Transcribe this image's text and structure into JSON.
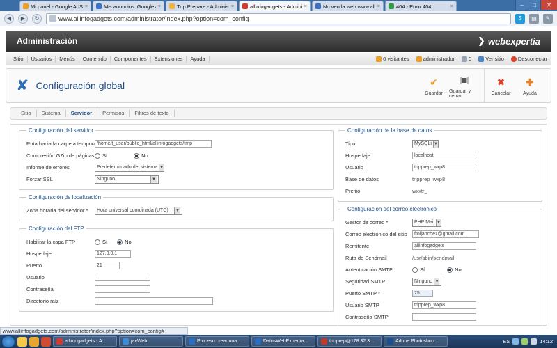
{
  "browser": {
    "tabs": [
      {
        "label": "Mi panel - Google AdSense",
        "color": "#f29d1e",
        "active": false
      },
      {
        "label": "Mis anuncios: Google AdWords",
        "color": "#3a73c9",
        "active": false
      },
      {
        "label": "Trip Prepare - Administración",
        "color": "#f1b33b",
        "active": false
      },
      {
        "label": "allinfogadgets - Administración",
        "color": "#d03b2d",
        "active": true
      },
      {
        "label": "No veo la web www.allinfogadgets",
        "color": "#3c6fc4",
        "active": false
      },
      {
        "label": "404 - Error 404",
        "color": "#2f9e44",
        "active": false
      }
    ],
    "url": "www.allinfogadgets.com/administrator/index.php?option=com_config"
  },
  "admin": {
    "title": "Administración",
    "brand": "webexpertia"
  },
  "menu": {
    "items": [
      "Sitio",
      "Usuarios",
      "Menús",
      "Contenido",
      "Componentes",
      "Extensiones",
      "Ayuda"
    ],
    "right": {
      "visitors": "0 visitantes",
      "admin": "administrador",
      "messages": "0",
      "view_site": "Ver sitio",
      "logout": "Desconectar"
    }
  },
  "toolbar": {
    "title": "Configuración global",
    "actions": [
      {
        "name": "save-button",
        "label": "Guardar",
        "icon": "check-icon",
        "glyph": "✔",
        "color": "#f39a1f"
      },
      {
        "name": "save-close-button",
        "label": "Guardar y cerrar",
        "icon": "disk-icon",
        "glyph": "▣",
        "color": "#555555"
      },
      {
        "name": "cancel-button",
        "label": "Cancelar",
        "icon": "cancel-icon",
        "glyph": "✖",
        "color": "#e0402b"
      },
      {
        "name": "help-button",
        "label": "Ayuda",
        "icon": "lifebuoy-icon",
        "glyph": "✚",
        "color": "#f07d1e"
      }
    ]
  },
  "subtabs": [
    "Sitio",
    "Sistema",
    "Servidor",
    "Permisos",
    "Filtros de texto"
  ],
  "subtabs_active": "Servidor",
  "server": {
    "legend": "Configuración del servidor",
    "tmp_label": "Ruta hacia la carpeta temporal",
    "tmp_value": "/home/t_user/public_html/allinfogadgets/tmp",
    "gzip_label": "Compresión GZip de páginas",
    "gzip_yes": "Sí",
    "gzip_no": "No",
    "errors_label": "Informe de errores",
    "errors_value": "Predeterminado del sistema",
    "ssl_label": "Forzar SSL",
    "ssl_value": "Ninguno"
  },
  "locale": {
    "legend": "Configuración de localización",
    "tz_label": "Zona horaria del servidor *",
    "tz_value": "Hora universal coordinada (UTC)"
  },
  "ftp": {
    "legend": "Configuración del FTP",
    "enable_label": "Habilitar la capa FTP",
    "yes": "Sí",
    "no": "No",
    "host_label": "Hospedaje",
    "host_value": "127.0.0.1",
    "port_label": "Puerto",
    "port_value": "21",
    "user_label": "Usuario",
    "user_value": "",
    "pass_label": "Contraseña",
    "pass_value": "",
    "root_label": "Directorio raíz",
    "root_value": ""
  },
  "database": {
    "legend": "Configuración de la base de datos",
    "type_label": "Tipo",
    "type_value": "MySQLi",
    "host_label": "Hospedaje",
    "host_value": "localhost",
    "user_label": "Usuario",
    "user_value": "tripprep_wxp8",
    "name_label": "Base de datos",
    "name_value": "tripprep_wxp8",
    "prefix_label": "Prefijo",
    "prefix_value": "wxxtr_"
  },
  "mail": {
    "legend": "Configuración del correo electrónico",
    "mailer_label": "Gestor de correo *",
    "mailer_value": "PHP Mail",
    "from_label": "Correo electrónico del sitio",
    "from_value": "ftoljanchez@gmail.com",
    "fromname_label": "Remitente",
    "fromname_value": "allinfogadgets",
    "sendmail_label": "Ruta de Sendmail",
    "sendmail_value": "/usr/sbin/sendmail",
    "auth_label": "Autenticación SMTP",
    "auth_yes": "Sí",
    "auth_no": "No",
    "security_label": "Seguridad SMTP",
    "security_value": "Ninguno",
    "port_label": "Puerto SMTP *",
    "port_value": "25",
    "smtpuser_label": "Usuario SMTP",
    "smtpuser_value": "tripprep_wxp8",
    "smtppass_label": "Contraseña SMTP",
    "smtppass_value": ""
  },
  "status": "www.allinfogadgets.com/administrator/index.php?option=com_config#",
  "taskbar": {
    "tasks": [
      {
        "label": "allinfogadgets - A...",
        "color": "#d03b2d"
      },
      {
        "label": "javWeb",
        "color": "#3c8dd6"
      },
      {
        "label": "Proceso crear una ...",
        "color": "#2a6ec1"
      },
      {
        "label": "DatosWebExpertia...",
        "color": "#2a6ec1"
      },
      {
        "label": "tripprep@178.32.3...",
        "color": "#c0392b"
      },
      {
        "label": "Adobe Photoshop ...",
        "color": "#1b4f8f"
      }
    ],
    "lang": "ES",
    "time": "14:12"
  }
}
